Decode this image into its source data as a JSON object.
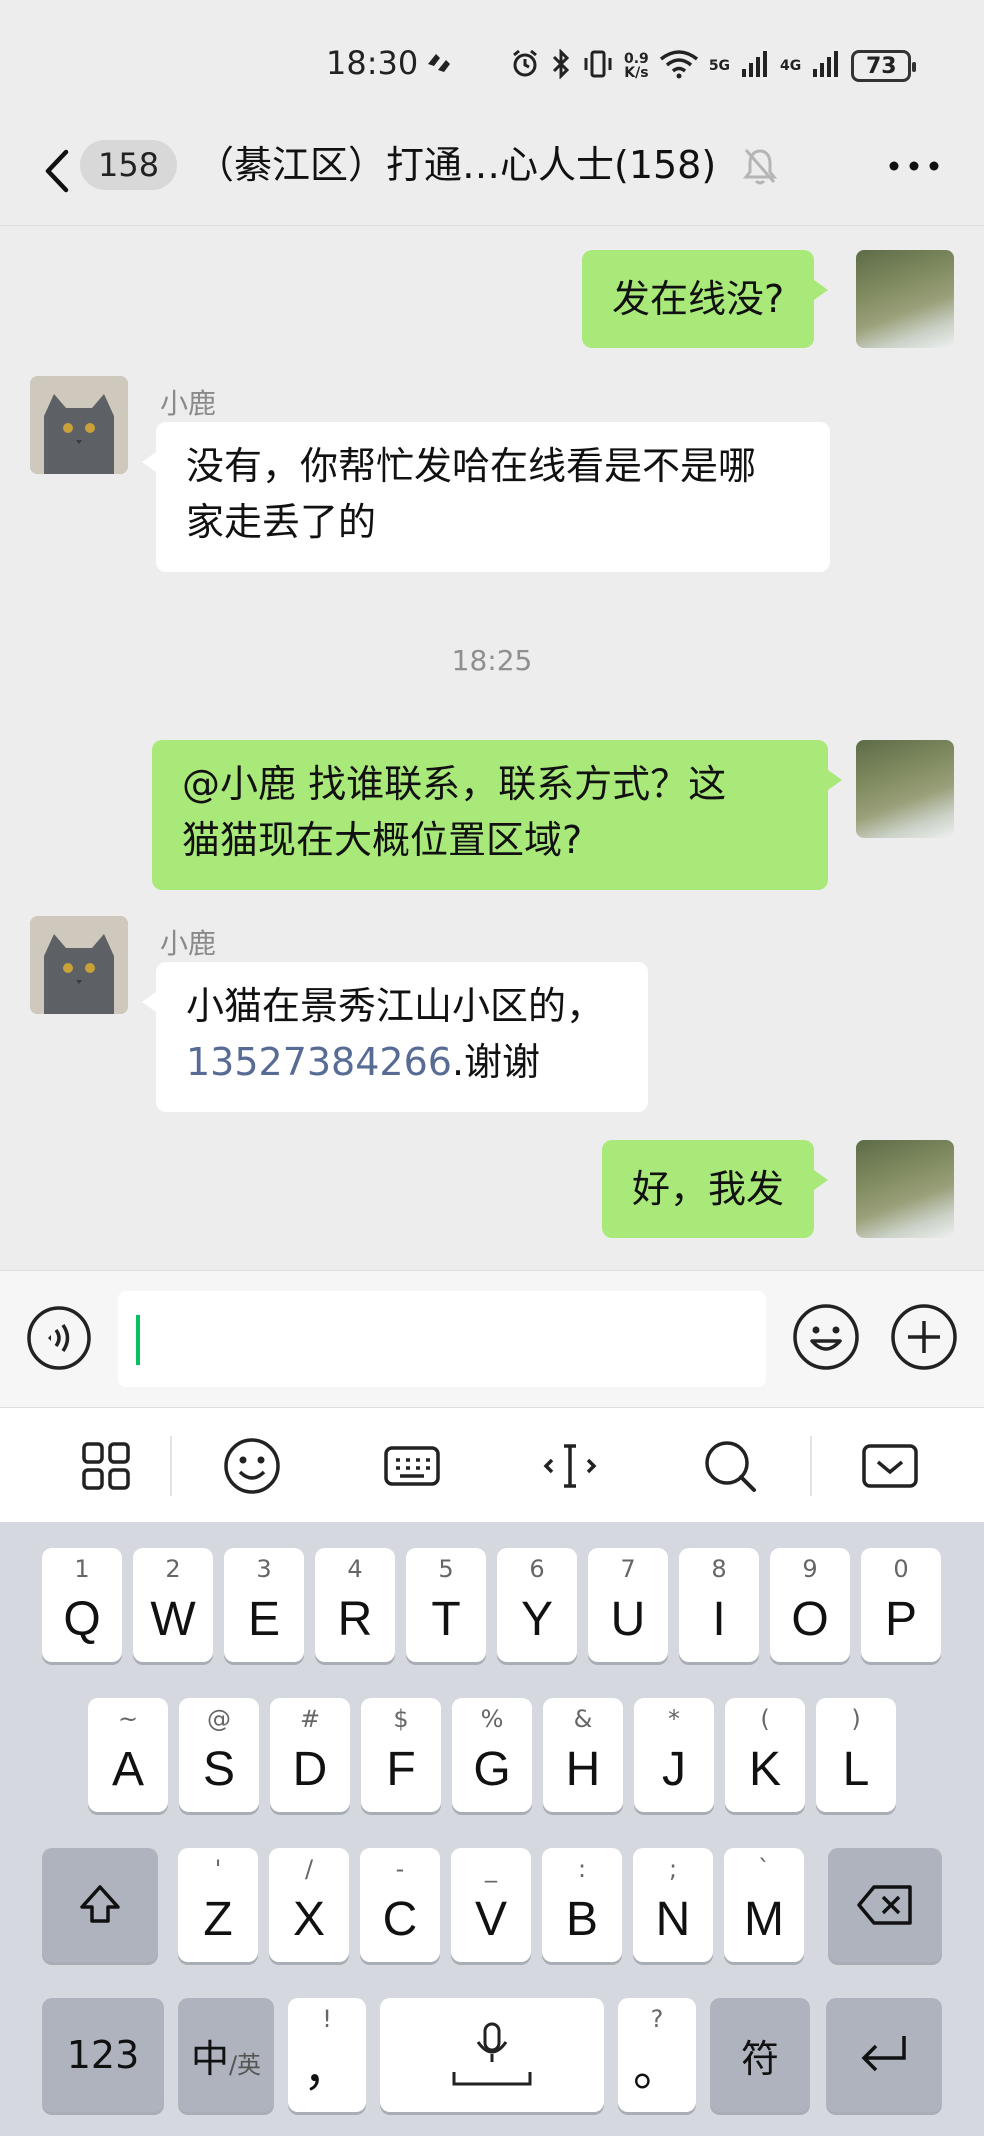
{
  "status_bar": {
    "time": "18:30",
    "speed_top": "0.9",
    "speed_bottom": "K/s",
    "net1": "5G",
    "net2": "4G",
    "battery": "73"
  },
  "header": {
    "unread_count": "158",
    "title": "（綦江区）打通…心人士(158)"
  },
  "messages": [
    {
      "side": "right",
      "text": "发在线没?"
    },
    {
      "side": "left",
      "sender": "小鹿",
      "text_line1": "没有，你帮忙发哈在线看是不是哪",
      "text_line2": "家走丢了的"
    },
    {
      "type": "time",
      "text": "18:25"
    },
    {
      "side": "right",
      "text_line1": "@小鹿  找谁联系，联系方式？这",
      "text_line2": "猫猫现在大概位置区域?"
    },
    {
      "side": "left",
      "sender": "小鹿",
      "text_line1": "小猫在景秀江山小区的，",
      "phone": "13527384266",
      "text_suffix": ".谢谢"
    },
    {
      "side": "right",
      "text": "好，我发"
    }
  ],
  "keyboard": {
    "row1": [
      {
        "hint": "1",
        "key": "Q"
      },
      {
        "hint": "2",
        "key": "W"
      },
      {
        "hint": "3",
        "key": "E"
      },
      {
        "hint": "4",
        "key": "R"
      },
      {
        "hint": "5",
        "key": "T"
      },
      {
        "hint": "6",
        "key": "Y"
      },
      {
        "hint": "7",
        "key": "U"
      },
      {
        "hint": "8",
        "key": "I"
      },
      {
        "hint": "9",
        "key": "O"
      },
      {
        "hint": "0",
        "key": "P"
      }
    ],
    "row2": [
      {
        "hint": "~",
        "key": "A"
      },
      {
        "hint": "@",
        "key": "S"
      },
      {
        "hint": "#",
        "key": "D"
      },
      {
        "hint": "$",
        "key": "F"
      },
      {
        "hint": "%",
        "key": "G"
      },
      {
        "hint": "&",
        "key": "H"
      },
      {
        "hint": "*",
        "key": "J"
      },
      {
        "hint": "(",
        "key": "K"
      },
      {
        "hint": ")",
        "key": "L"
      }
    ],
    "row3": [
      {
        "hint": "'",
        "key": "Z"
      },
      {
        "hint": "/",
        "key": "X"
      },
      {
        "hint": "-",
        "key": "C"
      },
      {
        "hint": "_",
        "key": "V"
      },
      {
        "hint": ":",
        "key": "B"
      },
      {
        "hint": ";",
        "key": "N"
      },
      {
        "hint": "`",
        "key": "M"
      }
    ],
    "num_key": "123",
    "lang_key_main": "中",
    "lang_key_sub": "/英",
    "comma_hint": "!",
    "comma_key": "，",
    "period_hint": "?",
    "period_key": "。",
    "symbol_key": "符"
  },
  "colors": {
    "chat_bg": "#ededed",
    "bubble_green": "#a9e97a",
    "bubble_white": "#ffffff",
    "link": "#576b95",
    "caret": "#07c160"
  }
}
